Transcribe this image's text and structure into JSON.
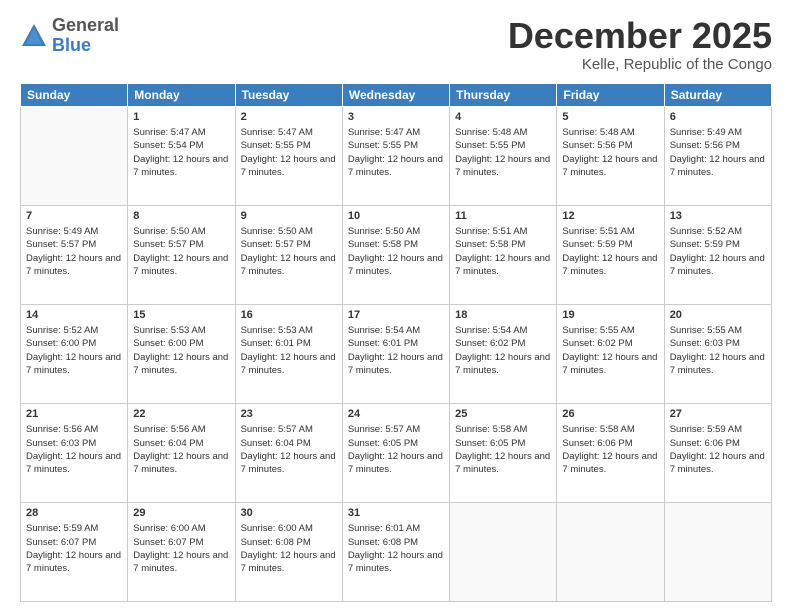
{
  "logo": {
    "general": "General",
    "blue": "Blue"
  },
  "header": {
    "month": "December 2025",
    "location": "Kelle, Republic of the Congo"
  },
  "weekdays": [
    "Sunday",
    "Monday",
    "Tuesday",
    "Wednesday",
    "Thursday",
    "Friday",
    "Saturday"
  ],
  "weeks": [
    [
      {
        "day": "",
        "sunrise": "",
        "sunset": "",
        "daylight": ""
      },
      {
        "day": "1",
        "sunrise": "Sunrise: 5:47 AM",
        "sunset": "Sunset: 5:54 PM",
        "daylight": "Daylight: 12 hours and 7 minutes."
      },
      {
        "day": "2",
        "sunrise": "Sunrise: 5:47 AM",
        "sunset": "Sunset: 5:55 PM",
        "daylight": "Daylight: 12 hours and 7 minutes."
      },
      {
        "day": "3",
        "sunrise": "Sunrise: 5:47 AM",
        "sunset": "Sunset: 5:55 PM",
        "daylight": "Daylight: 12 hours and 7 minutes."
      },
      {
        "day": "4",
        "sunrise": "Sunrise: 5:48 AM",
        "sunset": "Sunset: 5:55 PM",
        "daylight": "Daylight: 12 hours and 7 minutes."
      },
      {
        "day": "5",
        "sunrise": "Sunrise: 5:48 AM",
        "sunset": "Sunset: 5:56 PM",
        "daylight": "Daylight: 12 hours and 7 minutes."
      },
      {
        "day": "6",
        "sunrise": "Sunrise: 5:49 AM",
        "sunset": "Sunset: 5:56 PM",
        "daylight": "Daylight: 12 hours and 7 minutes."
      }
    ],
    [
      {
        "day": "7",
        "sunrise": "Sunrise: 5:49 AM",
        "sunset": "Sunset: 5:57 PM",
        "daylight": "Daylight: 12 hours and 7 minutes."
      },
      {
        "day": "8",
        "sunrise": "Sunrise: 5:50 AM",
        "sunset": "Sunset: 5:57 PM",
        "daylight": "Daylight: 12 hours and 7 minutes."
      },
      {
        "day": "9",
        "sunrise": "Sunrise: 5:50 AM",
        "sunset": "Sunset: 5:57 PM",
        "daylight": "Daylight: 12 hours and 7 minutes."
      },
      {
        "day": "10",
        "sunrise": "Sunrise: 5:50 AM",
        "sunset": "Sunset: 5:58 PM",
        "daylight": "Daylight: 12 hours and 7 minutes."
      },
      {
        "day": "11",
        "sunrise": "Sunrise: 5:51 AM",
        "sunset": "Sunset: 5:58 PM",
        "daylight": "Daylight: 12 hours and 7 minutes."
      },
      {
        "day": "12",
        "sunrise": "Sunrise: 5:51 AM",
        "sunset": "Sunset: 5:59 PM",
        "daylight": "Daylight: 12 hours and 7 minutes."
      },
      {
        "day": "13",
        "sunrise": "Sunrise: 5:52 AM",
        "sunset": "Sunset: 5:59 PM",
        "daylight": "Daylight: 12 hours and 7 minutes."
      }
    ],
    [
      {
        "day": "14",
        "sunrise": "Sunrise: 5:52 AM",
        "sunset": "Sunset: 6:00 PM",
        "daylight": "Daylight: 12 hours and 7 minutes."
      },
      {
        "day": "15",
        "sunrise": "Sunrise: 5:53 AM",
        "sunset": "Sunset: 6:00 PM",
        "daylight": "Daylight: 12 hours and 7 minutes."
      },
      {
        "day": "16",
        "sunrise": "Sunrise: 5:53 AM",
        "sunset": "Sunset: 6:01 PM",
        "daylight": "Daylight: 12 hours and 7 minutes."
      },
      {
        "day": "17",
        "sunrise": "Sunrise: 5:54 AM",
        "sunset": "Sunset: 6:01 PM",
        "daylight": "Daylight: 12 hours and 7 minutes."
      },
      {
        "day": "18",
        "sunrise": "Sunrise: 5:54 AM",
        "sunset": "Sunset: 6:02 PM",
        "daylight": "Daylight: 12 hours and 7 minutes."
      },
      {
        "day": "19",
        "sunrise": "Sunrise: 5:55 AM",
        "sunset": "Sunset: 6:02 PM",
        "daylight": "Daylight: 12 hours and 7 minutes."
      },
      {
        "day": "20",
        "sunrise": "Sunrise: 5:55 AM",
        "sunset": "Sunset: 6:03 PM",
        "daylight": "Daylight: 12 hours and 7 minutes."
      }
    ],
    [
      {
        "day": "21",
        "sunrise": "Sunrise: 5:56 AM",
        "sunset": "Sunset: 6:03 PM",
        "daylight": "Daylight: 12 hours and 7 minutes."
      },
      {
        "day": "22",
        "sunrise": "Sunrise: 5:56 AM",
        "sunset": "Sunset: 6:04 PM",
        "daylight": "Daylight: 12 hours and 7 minutes."
      },
      {
        "day": "23",
        "sunrise": "Sunrise: 5:57 AM",
        "sunset": "Sunset: 6:04 PM",
        "daylight": "Daylight: 12 hours and 7 minutes."
      },
      {
        "day": "24",
        "sunrise": "Sunrise: 5:57 AM",
        "sunset": "Sunset: 6:05 PM",
        "daylight": "Daylight: 12 hours and 7 minutes."
      },
      {
        "day": "25",
        "sunrise": "Sunrise: 5:58 AM",
        "sunset": "Sunset: 6:05 PM",
        "daylight": "Daylight: 12 hours and 7 minutes."
      },
      {
        "day": "26",
        "sunrise": "Sunrise: 5:58 AM",
        "sunset": "Sunset: 6:06 PM",
        "daylight": "Daylight: 12 hours and 7 minutes."
      },
      {
        "day": "27",
        "sunrise": "Sunrise: 5:59 AM",
        "sunset": "Sunset: 6:06 PM",
        "daylight": "Daylight: 12 hours and 7 minutes."
      }
    ],
    [
      {
        "day": "28",
        "sunrise": "Sunrise: 5:59 AM",
        "sunset": "Sunset: 6:07 PM",
        "daylight": "Daylight: 12 hours and 7 minutes."
      },
      {
        "day": "29",
        "sunrise": "Sunrise: 6:00 AM",
        "sunset": "Sunset: 6:07 PM",
        "daylight": "Daylight: 12 hours and 7 minutes."
      },
      {
        "day": "30",
        "sunrise": "Sunrise: 6:00 AM",
        "sunset": "Sunset: 6:08 PM",
        "daylight": "Daylight: 12 hours and 7 minutes."
      },
      {
        "day": "31",
        "sunrise": "Sunrise: 6:01 AM",
        "sunset": "Sunset: 6:08 PM",
        "daylight": "Daylight: 12 hours and 7 minutes."
      },
      {
        "day": "",
        "sunrise": "",
        "sunset": "",
        "daylight": ""
      },
      {
        "day": "",
        "sunrise": "",
        "sunset": "",
        "daylight": ""
      },
      {
        "day": "",
        "sunrise": "",
        "sunset": "",
        "daylight": ""
      }
    ]
  ]
}
